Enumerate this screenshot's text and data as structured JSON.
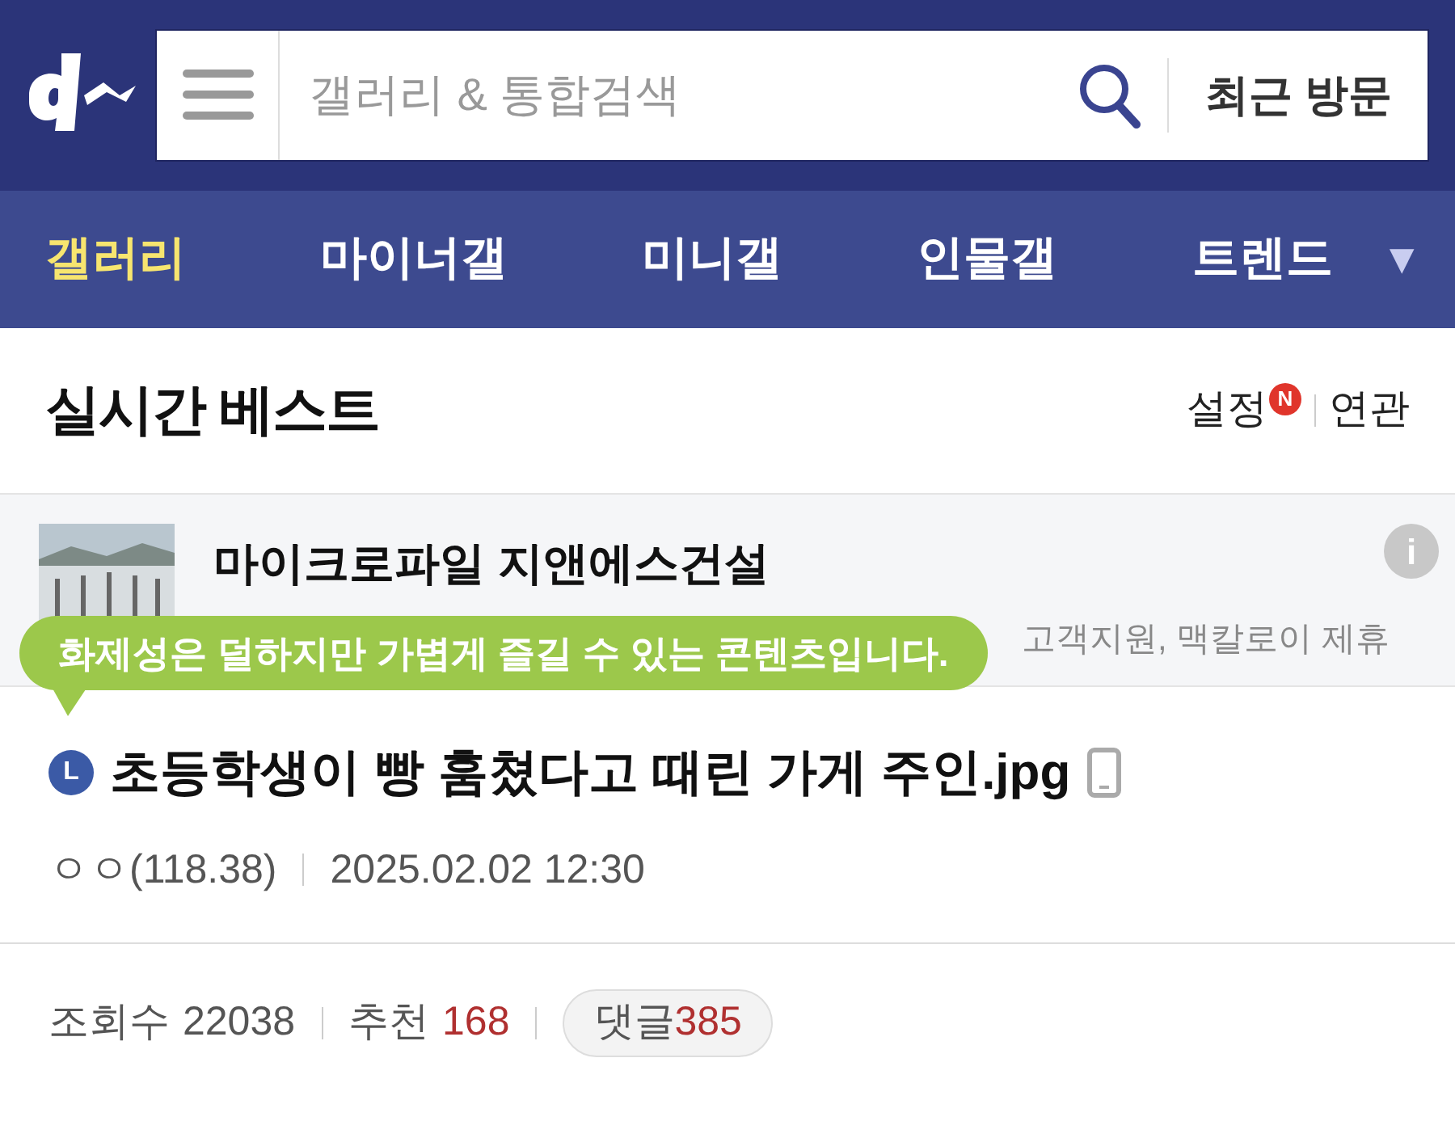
{
  "header": {
    "search": {
      "placeholder": "갤러리 & 통합검색"
    },
    "recent_button": "최근 방문"
  },
  "nav": {
    "tabs": [
      {
        "label": "갤러리",
        "selected": true
      },
      {
        "label": "마이너갤",
        "selected": false
      },
      {
        "label": "미니갤",
        "selected": false
      },
      {
        "label": "인물갤",
        "selected": false
      },
      {
        "label": "트렌드",
        "selected": false
      }
    ],
    "more": "▼"
  },
  "section": {
    "title": "실시간 베스트",
    "settings": "설정",
    "settings_badge": "N",
    "related": "연관"
  },
  "ad": {
    "title": "마이크로파일 지앤에스건설",
    "description": "고객지원, 맥칼로이 제휴",
    "info": "i"
  },
  "tooltip": "화제성은 덜하지만 가볍게 즐길 수 있는 콘텐츠입니다.",
  "post": {
    "badge": "L",
    "title": "초등학생이 빵 훔쳤다고 때린 가게 주인.jpg",
    "mobile": true,
    "author": "ㅇㅇ(118.38)",
    "date": "2025.02.02 12:30",
    "views_label": "조회수",
    "views": "22038",
    "recommend_label": "추천",
    "recommend": "168",
    "comments_label": "댓글",
    "comments": "385"
  }
}
